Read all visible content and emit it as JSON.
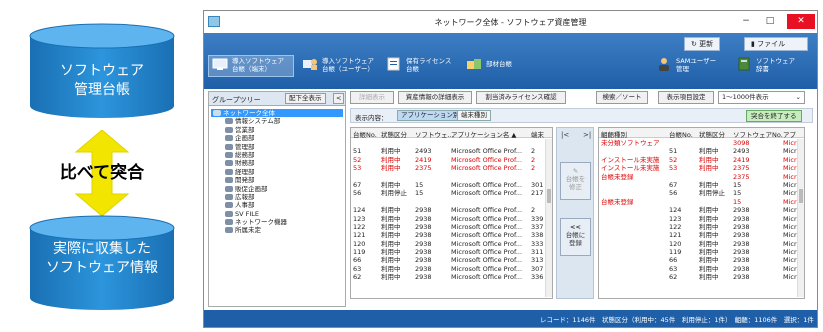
{
  "diagram": {
    "top_db_line1": "ソフトウェア",
    "top_db_line2": "管理台帳",
    "compare_label": "比べて突合",
    "bottom_db_line1": "実際に収集した",
    "bottom_db_line2": "ソフトウェア情報"
  },
  "window": {
    "title": "ネットワーク全体 - ソフトウェア資産管理",
    "minimize": "−",
    "maximize": "□",
    "close": "✕"
  },
  "ribbon": {
    "refresh": "更新",
    "file": "ファイル",
    "tools": [
      {
        "line1": "導入ソフトウェア",
        "line2": "台帳（端末）"
      },
      {
        "line1": "導入ソフトウェア",
        "line2": "台帳（ユーザー）"
      },
      {
        "line1": "保有ライセンス",
        "line2": "台帳"
      },
      {
        "line1": "部材台帳",
        "line2": ""
      },
      {
        "line1": "SAMユーザー",
        "line2": "管理"
      },
      {
        "line1": "ソフトウェア",
        "line2": "辞書"
      }
    ]
  },
  "group_tree": {
    "title": "グループツリー",
    "expand_all": "配下全表示",
    "collapse": "<",
    "nodes": [
      {
        "label": "ネットワーク全体",
        "level": 0,
        "selected": true
      },
      {
        "label": "情報システム部",
        "level": 1,
        "selected": false
      },
      {
        "label": "営業部",
        "level": 1,
        "selected": false
      },
      {
        "label": "企画部",
        "level": 1,
        "selected": false
      },
      {
        "label": "管理部",
        "level": 1,
        "selected": false
      },
      {
        "label": "総務部",
        "level": 1,
        "selected": false
      },
      {
        "label": "財務部",
        "level": 1,
        "selected": false
      },
      {
        "label": "経理部",
        "level": 1,
        "selected": false
      },
      {
        "label": "開発部",
        "level": 1,
        "selected": false
      },
      {
        "label": "販促企画部",
        "level": 1,
        "selected": false
      },
      {
        "label": "広報部",
        "level": 1,
        "selected": false
      },
      {
        "label": "人事部",
        "level": 1,
        "selected": false
      },
      {
        "label": "SV FILE",
        "level": 1,
        "selected": false
      },
      {
        "label": "ネットワーク機器",
        "level": 1,
        "selected": false
      },
      {
        "label": "所属未定",
        "level": 1,
        "selected": false
      }
    ]
  },
  "toolbar": {
    "detail_view": "詳細表示",
    "asset_detail": "資産情報の詳細表示",
    "license_check": "割当済みライセンス確認",
    "search_sort": "検索／ソート",
    "column_settings": "表示項目設定",
    "display_count": "1〜1000件表示",
    "display_content_label": "表示内容：",
    "tab_by_app": "アプリケーション別",
    "tab_by_terminal": "端末種別",
    "finish_reconcile": "突合を終了する"
  },
  "left_table": {
    "headers": [
      "台帳No.",
      "状態区分",
      "ソフトウェ...",
      "アプリケーション名 ▲",
      "端末"
    ],
    "rows": [
      {
        "c": [
          "",
          "",
          "",
          "",
          ""
        ],
        "red": false
      },
      {
        "c": [
          "51",
          "利用中",
          "2493",
          "Microsoft Office Prof...",
          "2"
        ],
        "red": false
      },
      {
        "c": [
          "52",
          "利用中",
          "2419",
          "Microsoft Office Prof...",
          "2"
        ],
        "red": true
      },
      {
        "c": [
          "53",
          "利用中",
          "2375",
          "Microsoft Office Prof...",
          "2"
        ],
        "red": true
      },
      {
        "c": [
          "",
          "",
          "",
          "",
          ""
        ],
        "red": false
      },
      {
        "c": [
          "67",
          "利用中",
          "15",
          "Microsoft Office Prof...",
          "301"
        ],
        "red": false
      },
      {
        "c": [
          "56",
          "利用停止",
          "15",
          "Microsoft Office Prof...",
          "217"
        ],
        "red": false
      },
      {
        "c": [
          "",
          "",
          "",
          "",
          ""
        ],
        "red": false
      },
      {
        "c": [
          "124",
          "利用中",
          "2938",
          "Microsoft Office Prof...",
          "2"
        ],
        "red": false
      },
      {
        "c": [
          "123",
          "利用中",
          "2938",
          "Microsoft Office Prof...",
          "339"
        ],
        "red": false
      },
      {
        "c": [
          "122",
          "利用中",
          "2938",
          "Microsoft Office Prof...",
          "337"
        ],
        "red": false
      },
      {
        "c": [
          "121",
          "利用中",
          "2938",
          "Microsoft Office Prof...",
          "338"
        ],
        "red": false
      },
      {
        "c": [
          "120",
          "利用中",
          "2938",
          "Microsoft Office Prof...",
          "333"
        ],
        "red": false
      },
      {
        "c": [
          "119",
          "利用中",
          "2938",
          "Microsoft Office Prof...",
          "311"
        ],
        "red": false
      },
      {
        "c": [
          "66",
          "利用中",
          "2938",
          "Microsoft Office Prof...",
          "313"
        ],
        "red": false
      },
      {
        "c": [
          "63",
          "利用中",
          "2938",
          "Microsoft Office Prof...",
          "307"
        ],
        "red": false
      },
      {
        "c": [
          "62",
          "利用中",
          "2938",
          "Microsoft Office Prof...",
          "336"
        ],
        "red": false
      }
    ]
  },
  "middle": {
    "nav_left": "|<",
    "nav_right": ">|",
    "btn_fix_line1": "台帳を",
    "btn_fix_line2": "修正",
    "btn_register_arrow": "<<",
    "btn_register_line1": "台帳に",
    "btn_register_line2": "登録"
  },
  "right_table": {
    "headers": [
      "齟齬種別",
      "台帳No.",
      "状態区分",
      "ソフトウェアNo.",
      "アプ"
    ],
    "rows": [
      {
        "c": [
          "未分類ソフトウェア",
          "",
          "",
          "3098",
          "Micr"
        ],
        "red": true
      },
      {
        "c": [
          "",
          "51",
          "利用中",
          "2493",
          "Micr"
        ],
        "red": false
      },
      {
        "c": [
          "インストール未実施",
          "52",
          "利用中",
          "2419",
          "Micr"
        ],
        "red": true
      },
      {
        "c": [
          "インストール未実施",
          "53",
          "利用中",
          "2375",
          "Micr"
        ],
        "red": true
      },
      {
        "c": [
          "台帳未登録",
          "",
          "",
          "2375",
          "Micr"
        ],
        "red": true
      },
      {
        "c": [
          "",
          "67",
          "利用中",
          "15",
          "Micr"
        ],
        "red": false
      },
      {
        "c": [
          "",
          "56",
          "利用停止",
          "15",
          "Micr"
        ],
        "red": false
      },
      {
        "c": [
          "台帳未登録",
          "",
          "",
          "15",
          "Micr"
        ],
        "red": true
      },
      {
        "c": [
          "",
          "124",
          "利用中",
          "2938",
          "Micr"
        ],
        "red": false
      },
      {
        "c": [
          "",
          "123",
          "利用中",
          "2938",
          "Micr"
        ],
        "red": false
      },
      {
        "c": [
          "",
          "122",
          "利用中",
          "2938",
          "Micr"
        ],
        "red": false
      },
      {
        "c": [
          "",
          "121",
          "利用中",
          "2938",
          "Micr"
        ],
        "red": false
      },
      {
        "c": [
          "",
          "120",
          "利用中",
          "2938",
          "Micr"
        ],
        "red": false
      },
      {
        "c": [
          "",
          "119",
          "利用中",
          "2938",
          "Micr"
        ],
        "red": false
      },
      {
        "c": [
          "",
          "66",
          "利用中",
          "2938",
          "Micr"
        ],
        "red": false
      },
      {
        "c": [
          "",
          "63",
          "利用中",
          "2938",
          "Micr"
        ],
        "red": false
      },
      {
        "c": [
          "",
          "62",
          "利用中",
          "2938",
          "Micr"
        ],
        "red": false
      }
    ]
  },
  "status": "レコード：1146件　状態区分（利用中：45件　利用停止：1件）　齟齬：1106件　選択：1件",
  "colors": {
    "accent": "#1f5fa8",
    "db_blue": "#1d82cc",
    "arrow_yellow": "#f2e600",
    "discrepancy_red": "#d00000"
  }
}
